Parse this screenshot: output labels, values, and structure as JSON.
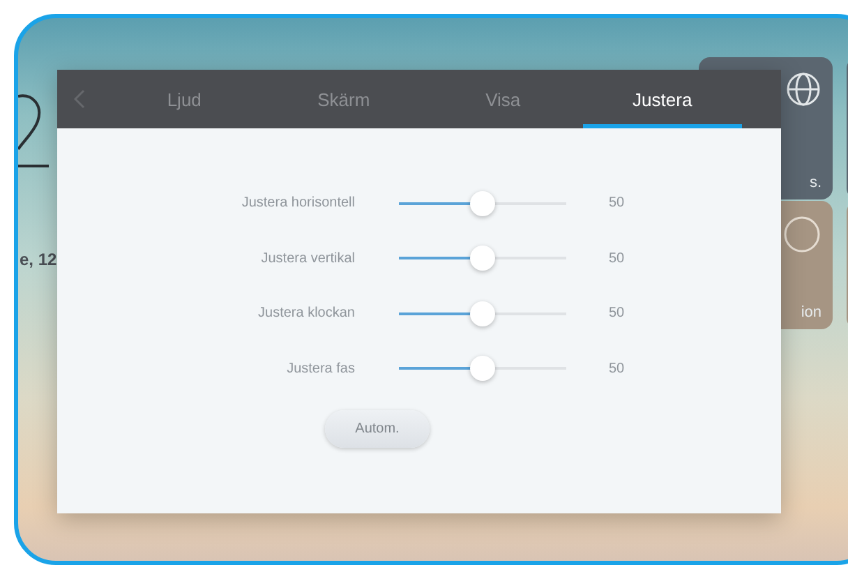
{
  "home": {
    "date": "e, 12",
    "tiles": [
      {
        "kind": "globe",
        "label": "s."
      },
      {
        "kind": "ring",
        "label": "ion"
      }
    ]
  },
  "dialog": {
    "tabs": [
      {
        "label": "Ljud",
        "selected": false
      },
      {
        "label": "Skärm",
        "selected": false
      },
      {
        "label": "Visa",
        "selected": false
      },
      {
        "label": "Justera",
        "selected": true
      }
    ],
    "sliders": [
      {
        "label": "Justera horisontell",
        "level": 0.5,
        "reading": "50"
      },
      {
        "label": "Justera vertikal",
        "level": 0.5,
        "reading": "50"
      },
      {
        "label": "Justera klockan",
        "level": 0.5,
        "reading": "50"
      },
      {
        "label": "Justera fas",
        "level": 0.5,
        "reading": "50"
      }
    ],
    "button": "Autom."
  }
}
